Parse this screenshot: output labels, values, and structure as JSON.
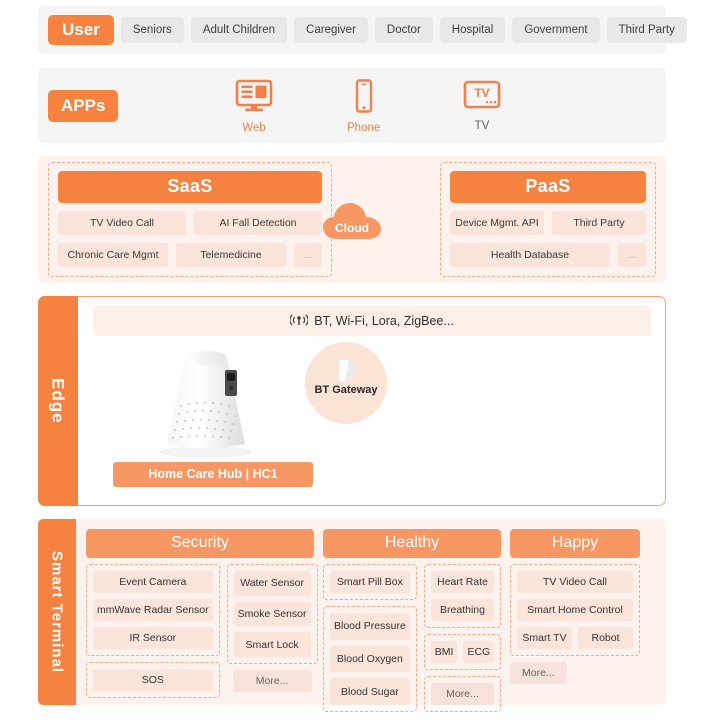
{
  "theme": {
    "accent": "#F6823F",
    "accent_light": "#F79763",
    "chip_bg": "#FBE4D9",
    "band_bg": "#FDF2EE",
    "grey_band": "#f5f5f5"
  },
  "user_row": {
    "badge": "User",
    "items": [
      "Seniors",
      "Adult Children",
      "Caregiver",
      "Doctor",
      "Hospital",
      "Government",
      "Third Party"
    ]
  },
  "apps_row": {
    "badge": "APPs",
    "items": [
      {
        "label": "Web",
        "icon": "monitor-icon"
      },
      {
        "label": "Phone",
        "icon": "phone-icon"
      },
      {
        "label": "TV",
        "icon": "tv-icon"
      }
    ]
  },
  "cloud": {
    "icon_label": "Cloud",
    "saas": {
      "title": "SaaS",
      "row1": [
        "TV Video Call",
        "AI Fall Detection"
      ],
      "row2": [
        "Chronic Care Mgmt",
        "Telemedicine"
      ],
      "row2_more": "..."
    },
    "paas": {
      "title": "PaaS",
      "row1": [
        "Device Mgmt. API",
        "Third Party"
      ],
      "row2": [
        "Health Database"
      ],
      "row2_more": "..."
    }
  },
  "edge": {
    "tab": "Edge",
    "radio_text": "BT, Wi-Fi, Lora, ZigBee...",
    "radio_icon": "wireless-broadcast-icon",
    "hub_label": "Home Care Hub | HC1",
    "hub_image": "home-care-hub-device",
    "gateway_label": "BT Gateway"
  },
  "smart_terminal": {
    "tab": "Smart Terminal",
    "columns": [
      {
        "title": "Security",
        "group_left": [
          "Event Camera",
          "mmWave Radar Sensor",
          "IR Sensor"
        ],
        "group_right": [
          "Water Sensor",
          "Smoke Sensor",
          "Smart Lock"
        ],
        "footer_left": "SOS",
        "footer_right": "More..."
      },
      {
        "title": "Healthy",
        "group_a": [
          "Smart Pill Box"
        ],
        "group_b": [
          "Blood Pressure",
          "Blood Oxygen",
          "Blood Sugar"
        ],
        "group_c": [
          "Heart Rate",
          "Breathing"
        ],
        "group_d": [
          "BMI",
          "ECG"
        ],
        "group_e": "More..."
      },
      {
        "title": "Happy",
        "group_main": [
          "TV Video Call",
          "Smart Home Control"
        ],
        "group_pair": [
          "Smart TV",
          "Robot"
        ],
        "footer": "More..."
      }
    ]
  }
}
